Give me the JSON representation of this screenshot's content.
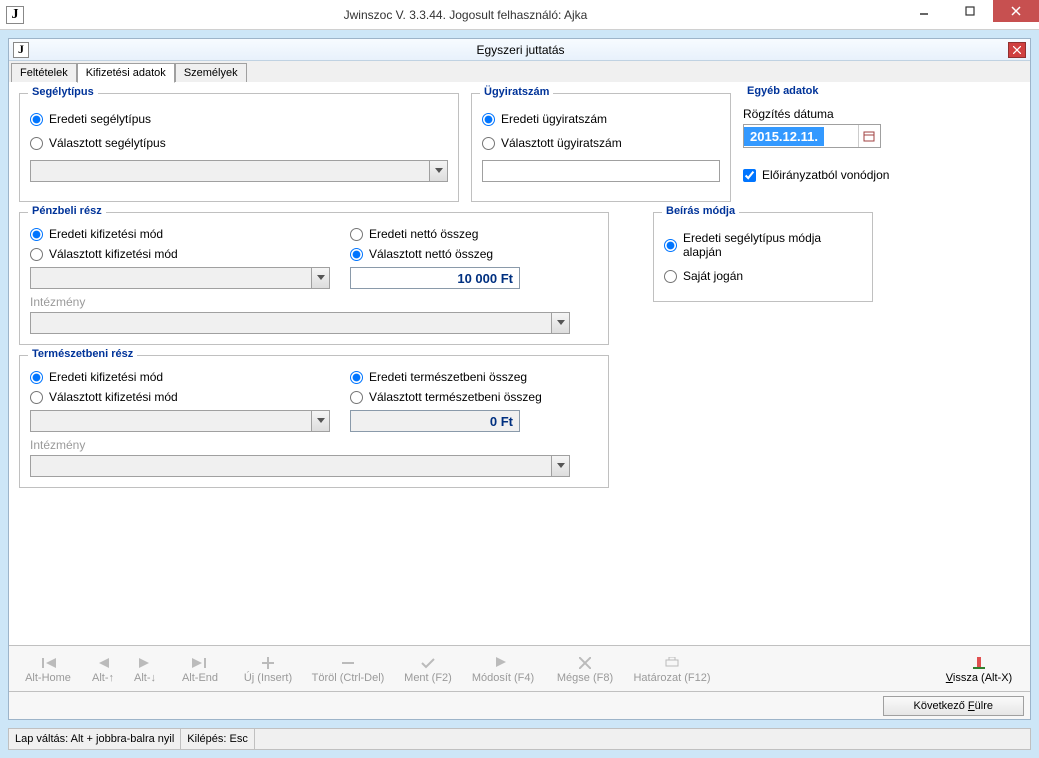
{
  "window": {
    "title": "Jwinszoc V. 3.3.44.  Jogosult felhasználó: Ajka",
    "app_letter": "J"
  },
  "inner": {
    "title": "Egyszeri juttatás"
  },
  "tabs": [
    "Feltételek",
    "Kifizetési adatok",
    "Személyek"
  ],
  "active_tab": 1,
  "segelytipus": {
    "legend": "Segélytípus",
    "opt_eredeti": "Eredeti segélytípus",
    "opt_valasztott": "Választott segélytípus"
  },
  "ugyiratszam": {
    "legend": "Ügyiratszám",
    "opt_eredeti": "Eredeti ügyiratszám",
    "opt_valasztott": "Választott ügyiratszám"
  },
  "egyeb": {
    "legend": "Egyéb adatok",
    "rogzites_label": "Rögzítés dátuma",
    "rogzites_date": "2015.12.11.",
    "eloiranyzat_label": "Előirányzatból vonódjon"
  },
  "penzbeli": {
    "legend": "Pénzbeli rész",
    "opt_eredeti_mod": "Eredeti kifizetési mód",
    "opt_valasztott_mod": "Választott kifizetési mód",
    "opt_eredeti_netto": "Eredeti nettó összeg",
    "opt_valasztott_netto": "Választott nettó összeg",
    "netto_value": "10 000 Ft",
    "intezmeny_label": "Intézmény"
  },
  "beiras": {
    "legend": "Beírás módja",
    "opt_eredeti": "Eredeti segélytípus módja alapján",
    "opt_sajat": "Saját jogán"
  },
  "termeszet": {
    "legend": "Természetbeni rész",
    "opt_eredeti_mod": "Eredeti kifizetési mód",
    "opt_valasztott_mod": "Választott kifizetési mód",
    "opt_eredeti_osszeg": "Eredeti természetbeni összeg",
    "opt_valasztott_osszeg": "Választott természetbeni összeg",
    "osszeg_value": "0 Ft",
    "intezmeny_label": "Intézmény"
  },
  "toolbar": {
    "alt_home": "Alt-Home",
    "alt_up": "Alt-↑",
    "alt_down": "Alt-↓",
    "alt_end": "Alt-End",
    "uj": "Új (Insert)",
    "torol": "Töröl (Ctrl-Del)",
    "ment": "Ment (F2)",
    "modosit": "Módosít (F4)",
    "megse": "Mégse (F8)",
    "hatarozat": "Határozat (F12)",
    "vissza": "Vissza (Alt-X)"
  },
  "next_button": "Következő Fülre",
  "status": {
    "lap_valtas": "Lap váltás: Alt + jobbra-balra nyil",
    "kilepes": "Kilépés: Esc"
  }
}
